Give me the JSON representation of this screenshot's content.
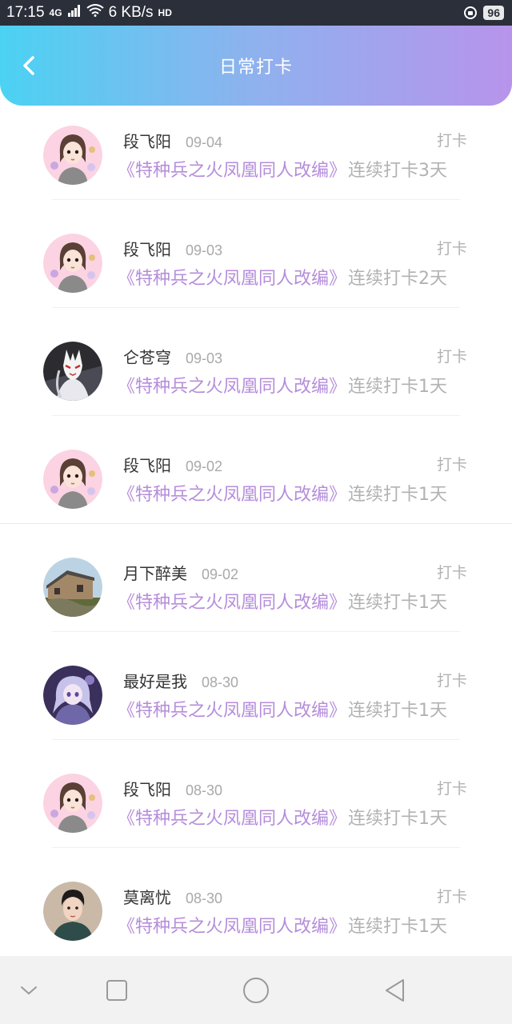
{
  "status_bar": {
    "time": "17:15",
    "network": "4G",
    "speed": "6 KB/s",
    "hd": "HD",
    "battery": "96"
  },
  "header": {
    "title": "日常打卡"
  },
  "checkins": [
    {
      "name": "段飞阳",
      "date": "09-04",
      "action": "打卡",
      "book": "《特种兵之火凤凰同人改编》",
      "streak": "连续打卡3天",
      "avatar": "girl-flowers"
    },
    {
      "name": "段飞阳",
      "date": "09-03",
      "action": "打卡",
      "book": "《特种兵之火凤凰同人改编》",
      "streak": "连续打卡2天",
      "avatar": "girl-flowers"
    },
    {
      "name": "仑苍穹",
      "date": "09-03",
      "action": "打卡",
      "book": "《特种兵之火凤凰同人改编》",
      "streak": "连续打卡1天",
      "avatar": "masked-warrior"
    },
    {
      "name": "段飞阳",
      "date": "09-02",
      "action": "打卡",
      "book": "《特种兵之火凤凰同人改编》",
      "streak": "连续打卡1天",
      "avatar": "girl-flowers"
    },
    {
      "name": "月下醉美",
      "date": "09-02",
      "action": "打卡",
      "book": "《特种兵之火凤凰同人改编》",
      "streak": "连续打卡1天",
      "avatar": "house"
    },
    {
      "name": "最好是我",
      "date": "08-30",
      "action": "打卡",
      "book": "《特种兵之火凤凰同人改编》",
      "streak": "连续打卡1天",
      "avatar": "anime-girl"
    },
    {
      "name": "段飞阳",
      "date": "08-30",
      "action": "打卡",
      "book": "《特种兵之火凤凰同人改编》",
      "streak": "连续打卡1天",
      "avatar": "girl-flowers"
    },
    {
      "name": "莫离忧",
      "date": "08-30",
      "action": "打卡",
      "book": "《特种兵之火凤凰同人改编》",
      "streak": "连续打卡1天",
      "avatar": "young-man"
    }
  ],
  "colors": {
    "header_gradient_start": "#4bd2f2",
    "header_gradient_end": "#b794eb",
    "book_title": "#b58ddb",
    "muted_text": "#b2b2b2"
  },
  "icons": {
    "back": "chevron-left-icon",
    "nav_down": "chevron-down-icon",
    "nav_recent": "square-icon",
    "nav_home": "circle-icon",
    "nav_back": "triangle-left-icon"
  }
}
